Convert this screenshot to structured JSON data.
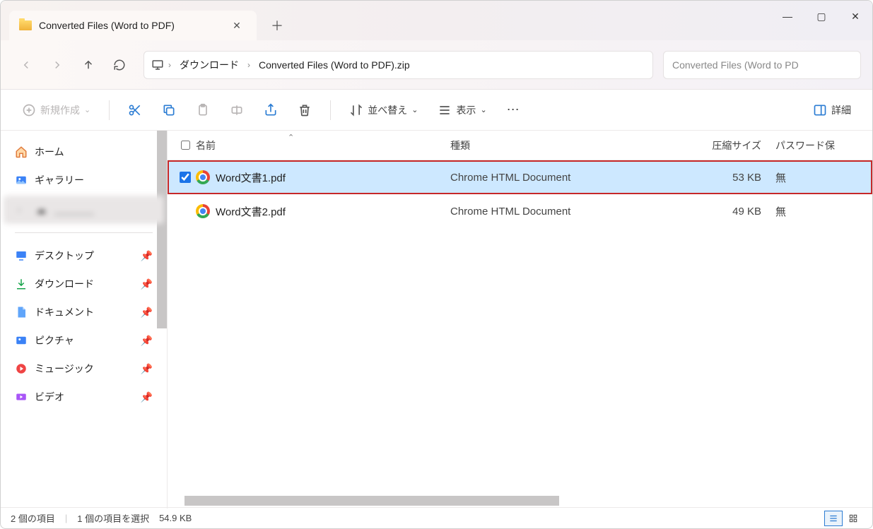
{
  "tab": {
    "title": "Converted Files (Word to PDF)"
  },
  "breadcrumb": {
    "segments": [
      "ダウンロード",
      "Converted Files (Word to PDF).zip"
    ]
  },
  "search": {
    "placeholder": "Converted Files (Word to PD"
  },
  "toolbar": {
    "new_label": "新規作成",
    "sort_label": "並べ替え",
    "view_label": "表示",
    "detail_label": "詳細"
  },
  "sidebar": {
    "home": "ホーム",
    "gallery": "ギャラリー",
    "hidden": "＿＿＿＿",
    "desktop": "デスクトップ",
    "downloads": "ダウンロード",
    "documents": "ドキュメント",
    "pictures": "ピクチャ",
    "music": "ミュージック",
    "video": "ビデオ"
  },
  "columns": {
    "name": "名前",
    "type": "種類",
    "size": "圧縮サイズ",
    "pwd": "パスワード保"
  },
  "files": [
    {
      "name": "Word文書1.pdf",
      "type": "Chrome HTML Document",
      "size": "53 KB",
      "pwd": "無",
      "selected": true
    },
    {
      "name": "Word文書2.pdf",
      "type": "Chrome HTML Document",
      "size": "49 KB",
      "pwd": "無",
      "selected": false
    }
  ],
  "status": {
    "count": "2 個の項目",
    "selection": "1 個の項目を選択",
    "size": "54.9 KB"
  }
}
